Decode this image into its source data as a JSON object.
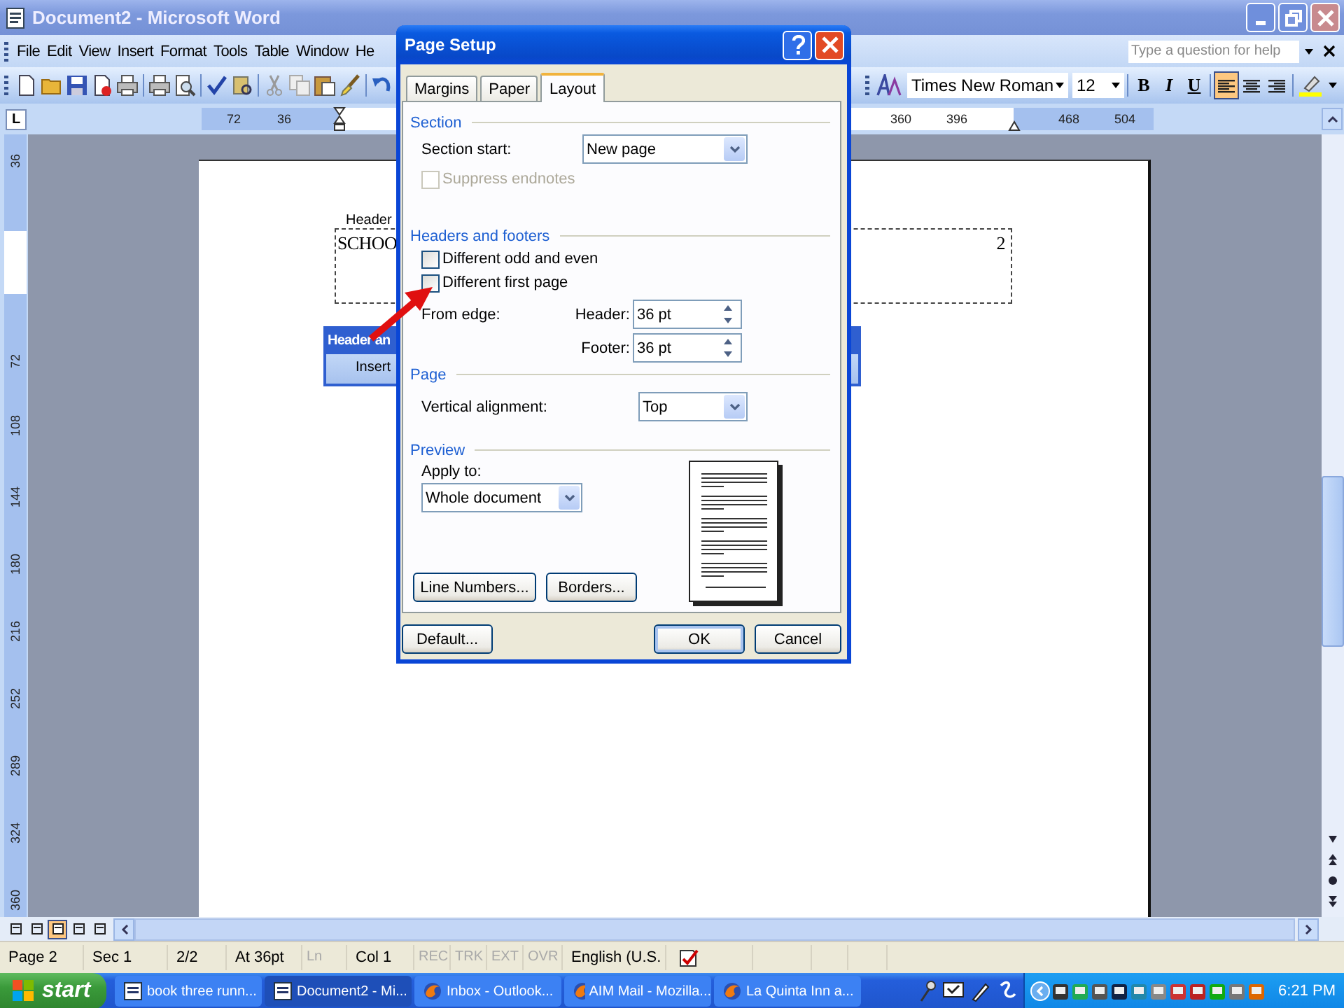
{
  "window": {
    "title": "Document2 - Microsoft Word"
  },
  "menu": [
    "File",
    "Edit",
    "View",
    "Insert",
    "Format",
    "Tools",
    "Table",
    "Window",
    "He"
  ],
  "help_box": {
    "placeholder": "Type a question for help"
  },
  "formatting": {
    "font": "Times New Roman",
    "size": "12",
    "bold": "B",
    "italic": "I",
    "underline": "U",
    "alignment": [
      {
        "selected": true
      },
      {
        "selected": false
      },
      {
        "selected": false
      }
    ]
  },
  "ruler": {
    "corner": "L",
    "marks": [
      "72",
      "36",
      "360",
      "396",
      "468",
      "504"
    ]
  },
  "vertical_ruler": [
    "36",
    "72",
    "108",
    "144",
    "180",
    "216",
    "252",
    "289",
    "324",
    "360"
  ],
  "document": {
    "header_label": "Header",
    "header_text": "SCHOO",
    "page_number": "2"
  },
  "header_footer_toolbar": {
    "title": "Header an",
    "button": "Insert"
  },
  "dialog": {
    "title": "Page Setup",
    "tabs": [
      {
        "label": "Margins",
        "selected": false
      },
      {
        "label": "Paper",
        "selected": false
      },
      {
        "label": "Layout",
        "selected": true
      }
    ],
    "section": {
      "heading": "Section",
      "start_label": "Section start:",
      "start_value": "New page",
      "suppress_endnotes": {
        "label": "Suppress endnotes",
        "checked": false,
        "disabled": true
      }
    },
    "headers_footers": {
      "heading": "Headers and footers",
      "options": [
        {
          "label": "Different odd and even",
          "checked": false,
          "disabled": false
        },
        {
          "label": "Different first page",
          "checked": false,
          "disabled": false
        }
      ],
      "from_edge_label": "From edge:",
      "header_label": "Header:",
      "header_value": "36 pt",
      "footer_label": "Footer:",
      "footer_value": "36 pt"
    },
    "page": {
      "heading": "Page",
      "alignment_label": "Vertical alignment:",
      "alignment_value": "Top"
    },
    "preview": {
      "heading": "Preview",
      "apply_label": "Apply to:",
      "apply_value": "Whole document",
      "buttons": [
        "Line Numbers...",
        "Borders..."
      ]
    },
    "buttons": [
      "Default...",
      "OK",
      "Cancel"
    ]
  },
  "view_buttons": [
    {
      "selected": false
    },
    {
      "selected": false
    },
    {
      "selected": true
    },
    {
      "selected": false
    },
    {
      "selected": false
    }
  ],
  "status_bar": [
    {
      "text": "Page 2",
      "disabled": false
    },
    {
      "text": "Sec 1",
      "disabled": false
    },
    {
      "text": "2/2",
      "disabled": false
    },
    {
      "text": "At 36pt",
      "disabled": false
    },
    {
      "text": "Ln",
      "disabled": true
    },
    {
      "text": "Col 1",
      "disabled": false
    },
    {
      "text": "REC",
      "disabled": true
    },
    {
      "text": "TRK",
      "disabled": true
    },
    {
      "text": "EXT",
      "disabled": true
    },
    {
      "text": "OVR",
      "disabled": true
    },
    {
      "text": "English (U.S.",
      "disabled": false
    }
  ],
  "taskbar": {
    "start": "start",
    "tasks": [
      {
        "label": "book three runn...",
        "kind": "word",
        "selected": false
      },
      {
        "label": "Document2 - Mi...",
        "kind": "word",
        "selected": true
      },
      {
        "label": "Inbox - Outlook...",
        "kind": "browser",
        "selected": false
      },
      {
        "label": "AIM Mail - Mozilla...",
        "kind": "browser",
        "selected": false
      },
      {
        "label": "La Quinta Inn a...",
        "kind": "browser",
        "selected": false
      }
    ],
    "clock": "6:21 PM"
  }
}
